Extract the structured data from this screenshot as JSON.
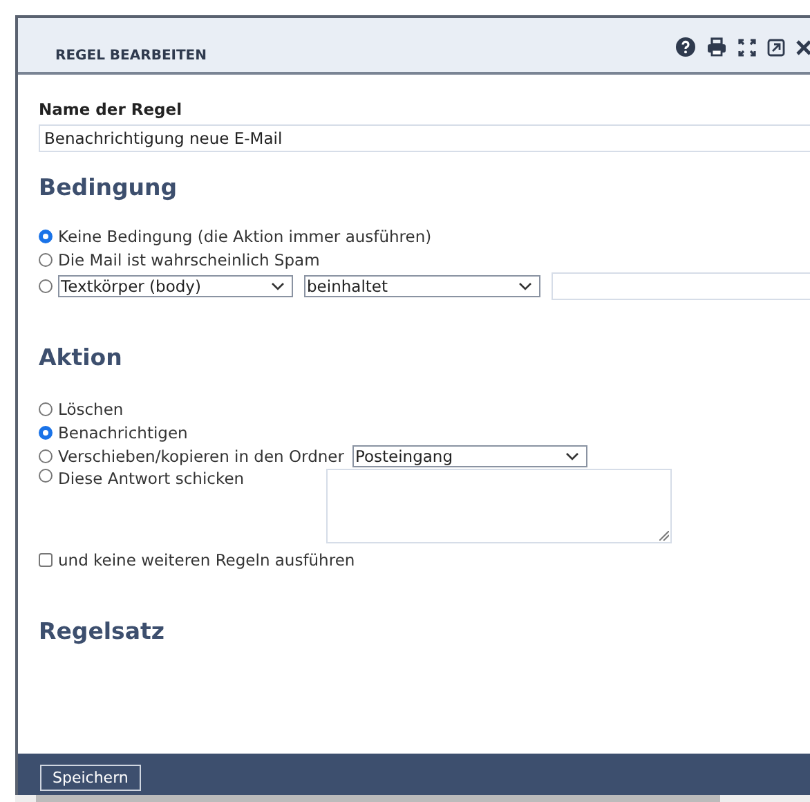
{
  "window": {
    "title": "REGEL BEARBEITEN"
  },
  "name_field": {
    "label": "Name der Regel",
    "value": "Benachrichtigung neue E-Mail"
  },
  "condition": {
    "heading": "Bedingung",
    "options": [
      {
        "kind": "text",
        "label": "Keine Bedingung (die Aktion immer ausführen)",
        "selected": true
      },
      {
        "kind": "text",
        "label": "Die Mail ist wahrscheinlich Spam",
        "selected": false
      },
      {
        "kind": "match",
        "field": "Textkörper (body)",
        "operator": "beinhaltet",
        "selected": false
      }
    ]
  },
  "action": {
    "heading": "Aktion",
    "options": [
      {
        "kind": "text",
        "label": "Löschen",
        "selected": false
      },
      {
        "kind": "text",
        "label": "Benachrichtigen",
        "selected": true
      },
      {
        "kind": "folder",
        "label": "Verschieben/kopieren in den Ordner",
        "folder": "Posteingang",
        "selected": false
      },
      {
        "kind": "reply",
        "label": "Diese Antwort schicken",
        "selected": false
      }
    ]
  },
  "stop_checkbox": {
    "label": "und keine weiteren Regeln ausführen",
    "checked": false
  },
  "ruleset": {
    "heading": "Regelsatz"
  },
  "footer": {
    "save_button": "Speichern"
  }
}
